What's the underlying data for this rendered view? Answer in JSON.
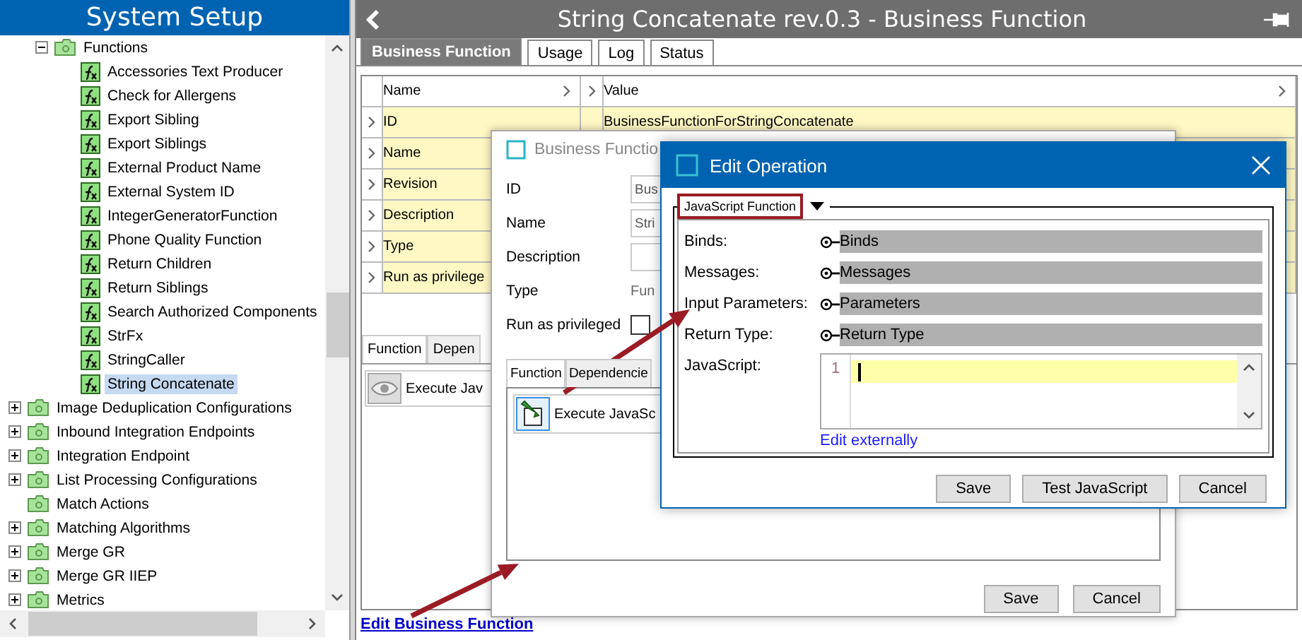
{
  "sidebar": {
    "title": "System Setup",
    "tree": [
      {
        "children": [
          {
            "label": "Functions",
            "kind": "folder",
            "expanded": true,
            "selected": false,
            "children": [
              {
                "label": "Accessories Text Producer",
                "kind": "function",
                "selected": false
              },
              {
                "label": "Check for Allergens",
                "kind": "function",
                "selected": false
              },
              {
                "label": "Export Sibling",
                "kind": "function",
                "selected": false
              },
              {
                "label": "Export Siblings",
                "kind": "function",
                "selected": false
              },
              {
                "label": "External Product Name",
                "kind": "function",
                "selected": false
              },
              {
                "label": "External System ID",
                "kind": "function",
                "selected": false
              },
              {
                "label": "IntegerGeneratorFunction",
                "kind": "function",
                "selected": false
              },
              {
                "label": "Phone Quality Function",
                "kind": "function",
                "selected": false
              },
              {
                "label": "Return Children",
                "kind": "function",
                "selected": false
              },
              {
                "label": "Return Siblings",
                "kind": "function",
                "selected": false
              },
              {
                "label": "Search Authorized Components",
                "kind": "function",
                "selected": false
              },
              {
                "label": "StrFx",
                "kind": "function",
                "selected": false
              },
              {
                "label": "StringCaller",
                "kind": "function",
                "selected": false
              },
              {
                "label": "String Concatenate",
                "kind": "function",
                "selected": true
              }
            ]
          }
        ]
      },
      {
        "label": "Image Deduplication Configurations",
        "kind": "folder",
        "expanded": false,
        "selected": false
      },
      {
        "label": "Inbound Integration Endpoints",
        "kind": "folder",
        "expanded": false,
        "selected": false
      },
      {
        "label": "Integration Endpoint",
        "kind": "folder",
        "expanded": false,
        "selected": false
      },
      {
        "label": "List Processing Configurations",
        "kind": "folder",
        "expanded": false,
        "selected": false
      },
      {
        "label": "Match Actions",
        "kind": "folder",
        "selected": false
      },
      {
        "label": "Matching Algorithms",
        "kind": "folder",
        "expanded": false,
        "selected": false
      },
      {
        "label": "Merge GR",
        "kind": "folder",
        "expanded": false,
        "selected": false
      },
      {
        "label": "Merge GR IIEP",
        "kind": "folder",
        "expanded": false,
        "selected": false
      },
      {
        "label": "Metrics",
        "kind": "folder",
        "expanded": false,
        "selected": false
      }
    ]
  },
  "editor": {
    "title": "String Concatenate rev.0.3 - Business Function",
    "tabs": [
      {
        "label": "Business Function",
        "selected": true
      },
      {
        "label": "Usage",
        "selected": false
      },
      {
        "label": "Log",
        "selected": false
      },
      {
        "label": "Status",
        "selected": false
      }
    ],
    "table": {
      "columns": [
        "Name",
        "Value"
      ],
      "rows": [
        {
          "name": "ID",
          "value": "BusinessFunctionForStringConcatenate"
        },
        {
          "name": "Name"
        },
        {
          "name": "Revision"
        },
        {
          "name": "Description"
        },
        {
          "name": "Type"
        },
        {
          "name": "Run as privilege"
        }
      ]
    },
    "lower_tabs": [
      {
        "label": "Function",
        "selected": true
      },
      {
        "label": "Depen",
        "selected": false
      }
    ],
    "operation": "Execute Jav",
    "link": "Edit Business Function"
  },
  "dialog": {
    "title": "Business Functio",
    "fields": [
      {
        "label": "ID",
        "kind": "input",
        "value": "Bus"
      },
      {
        "label": "Name",
        "kind": "input",
        "value": "Stri"
      },
      {
        "label": "Description",
        "kind": "input"
      },
      {
        "label": "Type",
        "kind": "text",
        "value": "Fun"
      },
      {
        "label": "Run as privileged",
        "kind": "checkbox",
        "checked": false
      }
    ],
    "tabs": [
      {
        "label": "Function",
        "selected": true
      },
      {
        "label": "Dependencie",
        "selected": false
      }
    ],
    "operation": "Execute JavaSc",
    "buttons": [
      "Save",
      "Cancel"
    ]
  },
  "edit_operation": {
    "title": "Edit Operation",
    "group": {
      "label": "JavaScript Function",
      "highlighted": true
    },
    "fields": [
      {
        "label": "Binds:",
        "value": "Binds"
      },
      {
        "label": "Messages:",
        "value": "Messages"
      },
      {
        "label": "Input Parameters:",
        "value": "Parameters"
      },
      {
        "label": "Return Type:",
        "value": "Return Type"
      }
    ],
    "script": {
      "label": "JavaScript:",
      "line_numbers": [
        "1"
      ]
    },
    "link": "Edit externally",
    "buttons": [
      "Save",
      "Test JavaScript",
      "Cancel"
    ]
  }
}
